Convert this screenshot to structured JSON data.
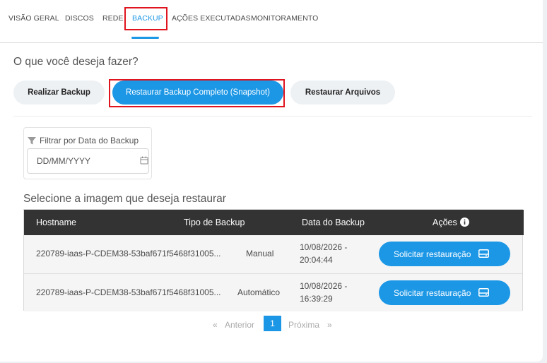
{
  "tabs": [
    "VISÃO GERAL",
    "DISCOS",
    "REDE",
    "BACKUP",
    "AÇÕES EXECUTADAS",
    "MONITORAMENTO"
  ],
  "active_tab": "BACKUP",
  "question": "O que você deseja fazer?",
  "actions": {
    "backup": "Realizar Backup",
    "snapshot": "Restaurar Backup Completo (Snapshot)",
    "files": "Restaurar Arquivos"
  },
  "filter": {
    "label": "Filtrar por Data do Backup",
    "placeholder": "DD/MM/YYYY",
    "icons": [
      "filter-icon",
      "calendar-icon"
    ]
  },
  "select_title": "Selecione a imagem que deseja restaurar",
  "table": {
    "headers": [
      "Hostname",
      "Tipo de Backup",
      "Data do Backup",
      "Ações"
    ],
    "rows": [
      {
        "hostname": "220789-iaas-P-CDEM38-53baf671f5468f31005...",
        "type": "Manual",
        "date": "10/08/2026 -",
        "time": "20:04:44",
        "action": "Solicitar restauração"
      },
      {
        "hostname": "220789-iaas-P-CDEM38-53baf671f5468f31005...",
        "type": "Automático",
        "date": "10/08/2026 -",
        "time": "16:39:29",
        "action": "Solicitar restauração"
      }
    ]
  },
  "pagination": {
    "prev_arrows": "«",
    "prev": "Anterior",
    "current": "1",
    "next": "Próxima",
    "next_arrows": "»"
  },
  "colors": {
    "accent": "#1c97e6",
    "highlight": "#e0141e",
    "table_header": "#333333"
  }
}
